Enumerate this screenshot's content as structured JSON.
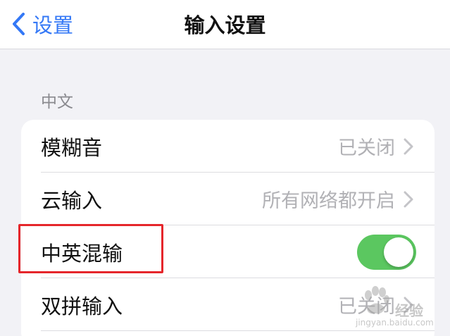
{
  "nav": {
    "back_label": "设置",
    "title": "输入设置"
  },
  "section": {
    "header": "中文"
  },
  "rows": [
    {
      "label": "模糊音",
      "value": "已关闭"
    },
    {
      "label": "云输入",
      "value": "所有网络都开启"
    },
    {
      "label": "中英混输",
      "toggle_on": true
    },
    {
      "label": "双拼输入",
      "value": "已关闭"
    }
  ],
  "watermark": {
    "brand": "经验",
    "url": "jingyan.baidu.com"
  },
  "colors": {
    "accent": "#3478f6",
    "toggle_on": "#5bc760",
    "highlight_box": "#e5262b",
    "background": "#f2f2f6"
  }
}
